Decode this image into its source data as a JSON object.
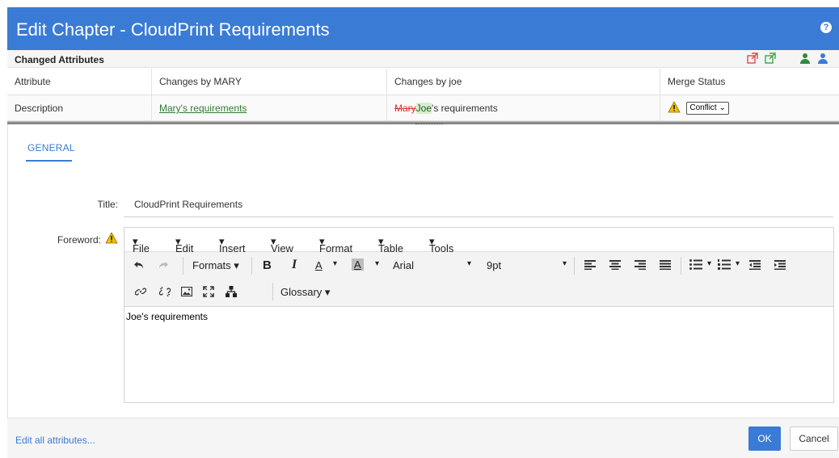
{
  "dialog": {
    "title": "Edit Chapter - CloudPrint Requirements",
    "help_icon": "help-icon",
    "accent_color": "#3a7bd5"
  },
  "changed_attributes": {
    "label": "Changed Attributes",
    "icons": [
      "apply-mine-icon",
      "apply-theirs-icon",
      "user-green-icon",
      "user-blue-icon"
    ],
    "columns": [
      "Attribute",
      "Changes by MARY",
      "Changes by joe",
      "Merge Status"
    ],
    "rows": [
      {
        "attribute": "Description",
        "changes_by_mary": "Mary's requirements",
        "changes_by_joe_deleted": "Mary",
        "changes_by_joe_inserted": "Joe",
        "changes_by_joe_rest": "'s requirements",
        "merge_status": "Conflict"
      }
    ]
  },
  "tabs": [
    {
      "label": "GENERAL",
      "active": true
    }
  ],
  "form": {
    "title_label": "Title:",
    "title_value": "CloudPrint Requirements",
    "foreword_label": "Foreword:"
  },
  "editor": {
    "menus": [
      "File",
      "Edit",
      "Insert",
      "View",
      "Format",
      "Table",
      "Tools"
    ],
    "toolbar": {
      "formats": "Formats",
      "bold": "B",
      "italic": "I",
      "font_color": "A",
      "bg_color": "A",
      "font_family": "Arial",
      "font_size": "9pt",
      "glossary": "Glossary"
    },
    "content": "Joe's requirements"
  },
  "footer": {
    "edit_all": "Edit all attributes...",
    "ok": "OK",
    "cancel": "Cancel"
  }
}
